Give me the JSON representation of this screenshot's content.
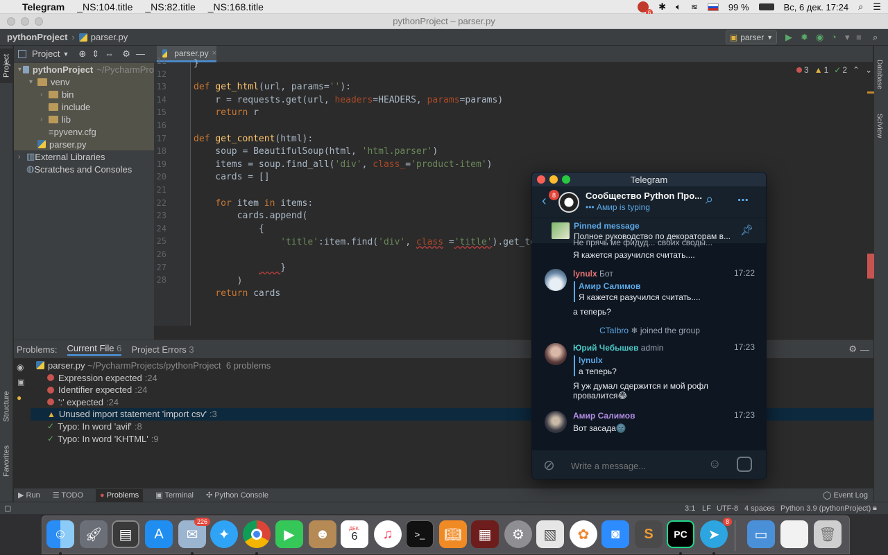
{
  "menubar": {
    "app": "Telegram",
    "items": [
      "_NS:104.title",
      "_NS:82.title",
      "_NS:168.title"
    ],
    "notif_count": "6",
    "flag": "RU",
    "battery": "99 %",
    "datetime": "Вс, 6 дек.  17:24"
  },
  "window_title": "pythonProject – parser.py",
  "nav": {
    "project": "pythonProject",
    "file": "parser.py",
    "run_config": "parser"
  },
  "left_tabs": [
    "Project",
    "Structure",
    "Favorites"
  ],
  "right_tabs": [
    "Database",
    "SciView"
  ],
  "project_panel": {
    "title": "Project",
    "tree": [
      {
        "label": "pythonProject",
        "suffix": "~/PycharmPro",
        "arrow": "▾",
        "indent": 0,
        "type": "folder-blue",
        "bold": true
      },
      {
        "label": "venv",
        "arrow": "▾",
        "indent": 1,
        "type": "folder"
      },
      {
        "label": "bin",
        "arrow": "›",
        "indent": 2,
        "type": "folder"
      },
      {
        "label": "include",
        "arrow": "",
        "indent": 2,
        "type": "folder"
      },
      {
        "label": "lib",
        "arrow": "›",
        "indent": 2,
        "type": "folder"
      },
      {
        "label": "pyvenv.cfg",
        "arrow": "",
        "indent": 2,
        "type": "cfg"
      },
      {
        "label": "parser.py",
        "arrow": "",
        "indent": 1,
        "type": "py"
      },
      {
        "label": "External Libraries",
        "arrow": "›",
        "indent": 0,
        "type": "lib"
      },
      {
        "label": "Scratches and Consoles",
        "arrow": "",
        "indent": 0,
        "type": "scratch"
      }
    ]
  },
  "editor": {
    "tab": "parser.py",
    "inspections": {
      "errors": "3",
      "warnings": "1",
      "ok": "2"
    },
    "line_numbers": [
      "11",
      "12",
      "13",
      "14",
      "15",
      "16",
      "17",
      "18",
      "19",
      "20",
      "21",
      "22",
      "23",
      "24",
      "25",
      "26",
      "27",
      "28"
    ]
  },
  "problems": {
    "label": "Problems:",
    "tabs": [
      {
        "name": "Current File",
        "count": "6"
      },
      {
        "name": "Project Errors",
        "count": "3"
      }
    ],
    "file": "parser.py",
    "path": "~/PycharmProjects/pythonProject",
    "count_text": "6 problems",
    "items": [
      {
        "kind": "error",
        "text": "Expression expected",
        "loc": ":24"
      },
      {
        "kind": "error",
        "text": "Identifier expected",
        "loc": ":24"
      },
      {
        "kind": "error",
        "text": "':' expected",
        "loc": ":24"
      },
      {
        "kind": "warning",
        "text": "Unused import statement 'import csv'",
        "loc": ":3"
      },
      {
        "kind": "typo",
        "text": "Typo: In word 'avif'",
        "loc": ":8"
      },
      {
        "kind": "typo",
        "text": "Typo: In word 'KHTML'",
        "loc": ":9"
      }
    ]
  },
  "tool_tabs": [
    "Run",
    "TODO",
    "Problems",
    "Terminal",
    "Python Console"
  ],
  "event_log": "Event Log",
  "status": {
    "position": "3:1",
    "line_sep": "LF",
    "encoding": "UTF-8",
    "indent": "4 spaces",
    "interpreter": "Python 3.9 (pythonProject)"
  },
  "dock": {
    "badges": {
      "mail": "226",
      "telegram": "8"
    },
    "calendar_month": "ДЕК.",
    "calendar_day": "6"
  },
  "telegram": {
    "title": "Telegram",
    "unread": "8",
    "chat_name": "Сообщество Python Про...",
    "typing": "Амир is typing",
    "pinned_label": "Pinned message",
    "pinned_text": "Полное руководство по декораторам в...",
    "cut_text": "Не прячь ме фидуд... своих своды...",
    "first_text": "Я кажется разучился считать....",
    "messages": [
      {
        "name": "lynulx",
        "tag": "Бот",
        "time": "17:22",
        "reply_name": "Амир Салимов",
        "reply_text": "Я кажется разучился считать....",
        "text": "а теперь?"
      },
      {
        "name": "Юрий Чебышев",
        "tag": "admin",
        "time": "17:23",
        "reply_name": "lynulx",
        "reply_text": "а теперь?",
        "text": "Я уж думал сдержится и мой рофл",
        "text2": "провалится😂"
      },
      {
        "name": "Амир Салимов",
        "tag": "",
        "time": "17:23",
        "text": "Вот засада🌚"
      }
    ],
    "service": {
      "user": "CTaIbro",
      "action": "joined the group"
    },
    "input_placeholder": "Write a message..."
  },
  "colors": {
    "accent": "#4a88c7",
    "tg_accent": "#5ca8e6",
    "error": "#c75450"
  }
}
